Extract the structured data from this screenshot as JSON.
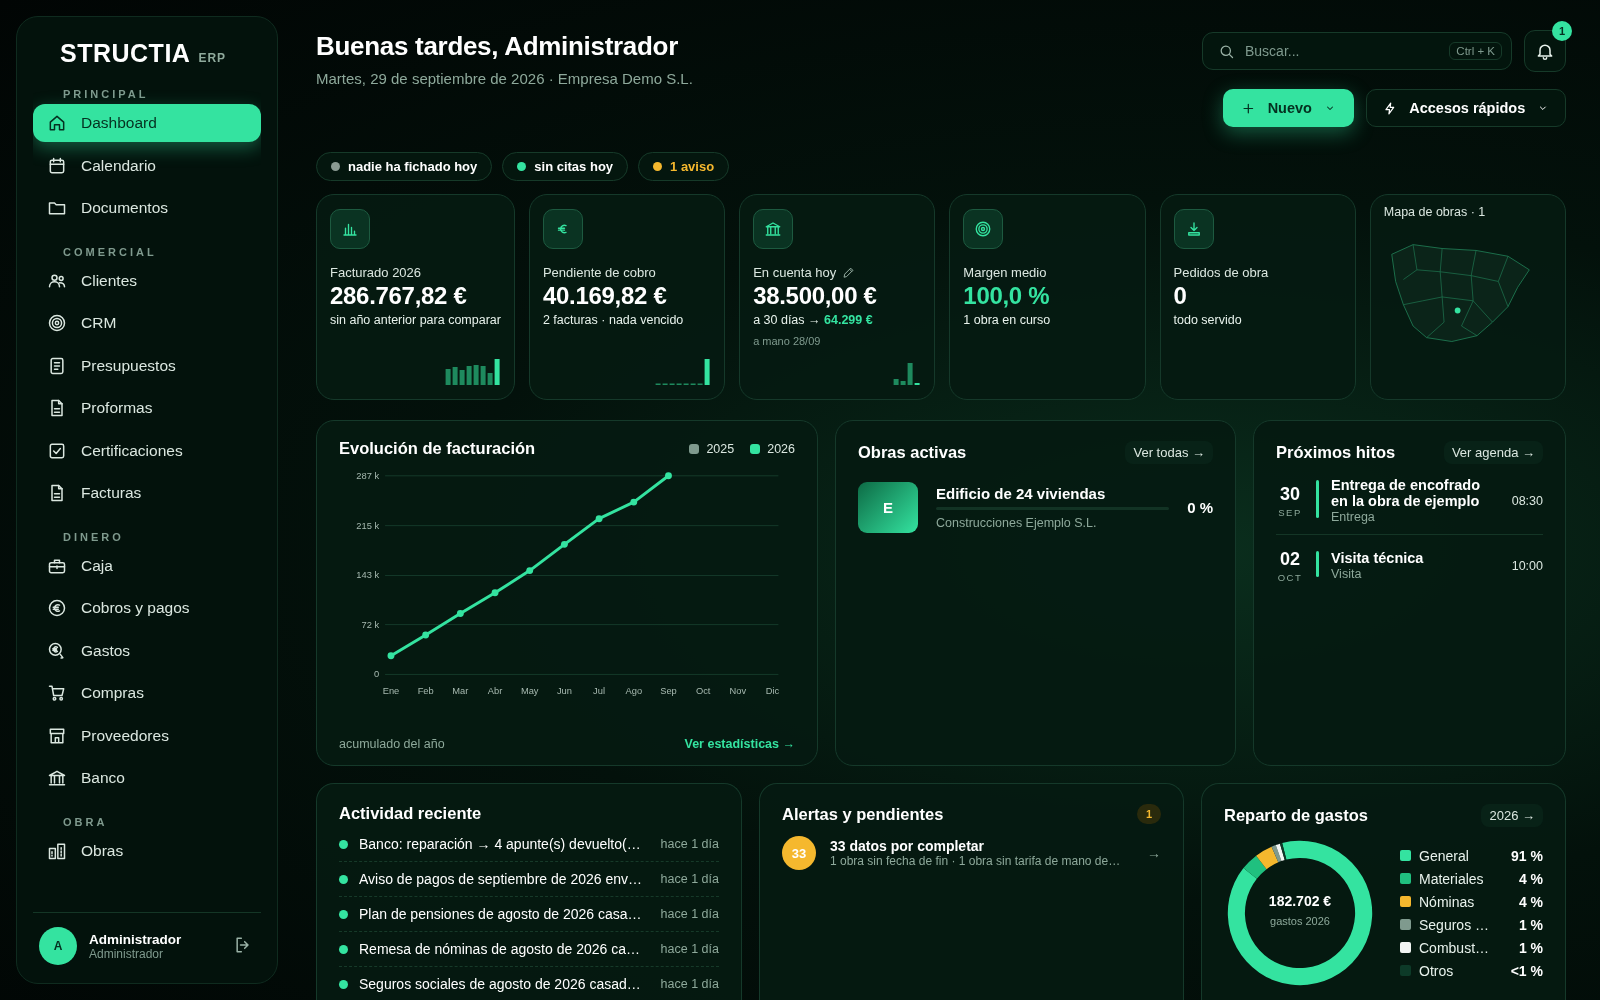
{
  "sidebar": {
    "logo": "STRUCTIA",
    "logo_suffix": "ERP",
    "sections": [
      {
        "title": "PRINCIPAL",
        "items": [
          {
            "label": "Dashboard",
            "selected": true
          },
          {
            "label": "Calendario",
            "selected": false
          },
          {
            "label": "Documentos",
            "selected": false
          }
        ]
      },
      {
        "title": "COMERCIAL",
        "items": [
          {
            "label": "Clientes",
            "selected": false
          },
          {
            "label": "CRM",
            "selected": false
          },
          {
            "label": "Presupuestos",
            "selected": false
          },
          {
            "label": "Proformas",
            "selected": false
          },
          {
            "label": "Certificaciones",
            "selected": false
          },
          {
            "label": "Facturas",
            "selected": false
          }
        ]
      },
      {
        "title": "DINERO",
        "items": [
          {
            "label": "Caja",
            "selected": false
          },
          {
            "label": "Cobros y pagos",
            "selected": false
          },
          {
            "label": "Gastos",
            "selected": false
          },
          {
            "label": "Compras",
            "selected": false
          },
          {
            "label": "Proveedores",
            "selected": false
          },
          {
            "label": "Banco",
            "selected": false
          }
        ]
      },
      {
        "title": "OBRA",
        "items": [
          {
            "label": "Obras",
            "selected": false
          }
        ]
      }
    ],
    "user": {
      "avatar": "A",
      "name": "Administrador",
      "role": "Administrador"
    }
  },
  "header": {
    "title": "Buenas tardes, Administrador",
    "subtitle": "Martes, 29 de septiembre de 2026 · Empresa Demo S.L.",
    "search": {
      "placeholder": "Buscar...",
      "shortcut": "Ctrl + K"
    },
    "notifications": "1",
    "buttons": [
      {
        "label": "Nuevo",
        "kind": "primary"
      },
      {
        "label": "Accesos rápidos",
        "kind": "secondary"
      }
    ]
  },
  "chips": [
    {
      "label": "nadie ha fichado hoy",
      "color": "#8a9a92",
      "kind": "neutral"
    },
    {
      "label": "sin citas hoy",
      "color": "#34e3a0",
      "kind": "neutral"
    },
    {
      "label": "1 aviso",
      "color": "#f5b82e",
      "kind": "warning"
    }
  ],
  "kpis": [
    {
      "label": "Facturado 2026",
      "editable": false,
      "value": "286.767,82 €",
      "highlight": false,
      "sub": "sin año anterior para comparar"
    },
    {
      "label": "Pendiente de cobro",
      "editable": false,
      "value": "40.169,82 €",
      "highlight": false,
      "sub": "2 facturas · nada vencido"
    },
    {
      "label": "En cuenta hoy",
      "editable": true,
      "value": "38.500,00 €",
      "highlight": false,
      "sub": "a 30 días → **64.299 €**",
      "note": "a mano 28/09"
    },
    {
      "label": "Margen medio",
      "editable": false,
      "value": "100,0 %",
      "highlight": true,
      "sub": "1 obra en curso"
    },
    {
      "label": "Pedidos de obra",
      "editable": false,
      "value": "0",
      "highlight": false,
      "sub": "todo servido"
    }
  ],
  "map": {
    "title": "Mapa de obras · 1"
  },
  "billing": {
    "title": "Evolución de facturación",
    "footer": "acumulado del año",
    "link": "Ver estadísticas →",
    "chart_data": {
      "type": "line",
      "categories": [
        "Ene",
        "Feb",
        "Mar",
        "Abr",
        "May",
        "Jun",
        "Jul",
        "Ago",
        "Sep",
        "Oct",
        "Nov",
        "Dic"
      ],
      "series": [
        {
          "name": "2025",
          "color": "#7f9a8e",
          "values": [
            null,
            null,
            null,
            null,
            null,
            null,
            null,
            null,
            null,
            null,
            null,
            null
          ]
        },
        {
          "name": "2026",
          "color": "#34e3a0",
          "marker": "circle",
          "values": [
            27,
            57,
            88,
            118,
            150,
            188,
            225,
            249,
            287,
            null,
            null,
            null
          ]
        }
      ],
      "grid": true,
      "ylim": [
        0,
        287
      ],
      "yticks": [
        {
          "value": 0,
          "label": "0"
        },
        {
          "value": 72,
          "label": "72 k"
        },
        {
          "value": 143,
          "label": "143 k"
        },
        {
          "value": 215,
          "label": "215 k"
        },
        {
          "value": 287,
          "label": "287 k"
        }
      ]
    }
  },
  "works": {
    "title": "Obras activas",
    "link": "Ver todas →",
    "items": [
      {
        "avatar": "E",
        "name": "Edificio de 24 viviendas",
        "company": "Construcciones Ejemplo S.L.",
        "percent": "0 %"
      }
    ]
  },
  "milestones": {
    "title": "Próximos hitos",
    "link": "Ver agenda →",
    "items": [
      {
        "day": "30",
        "month": "SEP",
        "title": "Entrega de encofrado en la obra de ejemplo",
        "type": "Entrega",
        "time": "08:30"
      },
      {
        "day": "02",
        "month": "OCT",
        "title": "Visita técnica",
        "type": "Visita",
        "time": "10:00"
      }
    ]
  },
  "activity": {
    "title": "Actividad reciente",
    "items": [
      {
        "text": "Banco: reparación → 4 apunte(s) devuelto(…",
        "time": "hace 1 día"
      },
      {
        "text": "Aviso de pagos de septiembre de 2026 env…",
        "time": "hace 1 día"
      },
      {
        "text": "Plan de pensiones de agosto de 2026 casa…",
        "time": "hace 1 día"
      },
      {
        "text": "Remesa de nóminas de agosto de 2026 ca…",
        "time": "hace 1 día"
      },
      {
        "text": "Seguros sociales de agosto de 2026 casad…",
        "time": "hace 1 día"
      }
    ]
  },
  "alerts": {
    "title": "Alertas y pendientes",
    "count": "1",
    "items": [
      {
        "badge": "33",
        "title": "33 datos por completar",
        "detail": "1 obra sin fecha de fin · 1 obra sin tarifa de mano de…",
        "arrow": "→"
      }
    ]
  },
  "expenses": {
    "title": "Reparto de gastos",
    "link": "2026 →",
    "total": "182.702 €",
    "total_label": "gastos 2026",
    "chart_data": {
      "type": "donut",
      "categories": [
        "General",
        "Materiales",
        "Nóminas",
        "Seguros …",
        "Combust…",
        "Otros"
      ],
      "values": [
        91,
        4,
        4,
        1,
        1,
        0.5
      ],
      "value_labels": [
        "91 %",
        "4 %",
        "4 %",
        "1 %",
        "1 %",
        "<1 %"
      ],
      "colors": [
        "#34e3a0",
        "#20c07f",
        "#f5b82e",
        "#7f9a8e",
        "#f2f5f3",
        "#0d3a28"
      ]
    }
  }
}
